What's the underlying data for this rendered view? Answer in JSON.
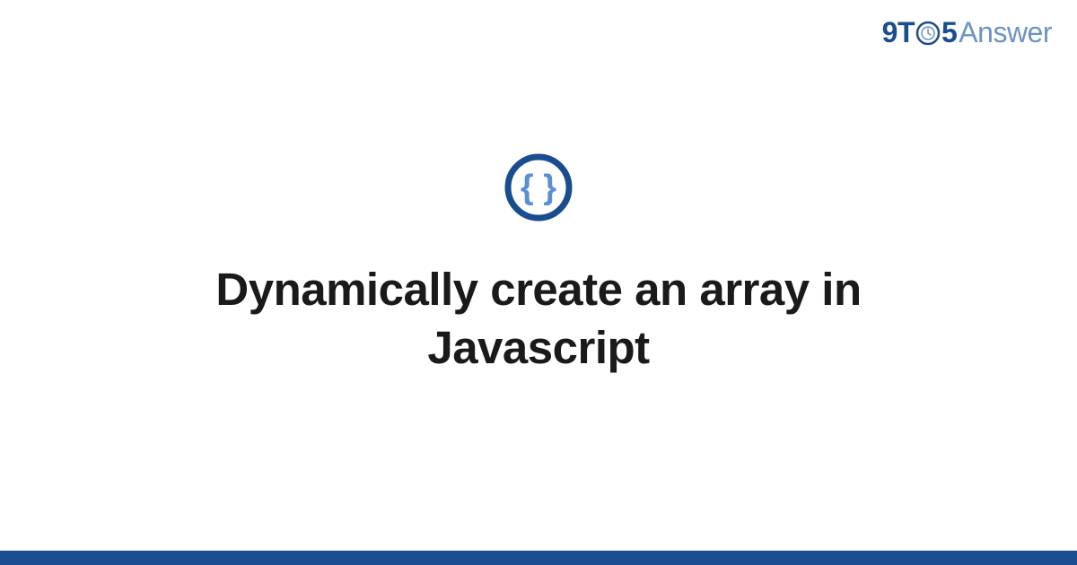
{
  "logo": {
    "part1": "9T",
    "part2": "5",
    "part3": "Answer"
  },
  "title": "Dynamically create an array in Javascript",
  "colors": {
    "primary": "#1a4d8f",
    "secondary": "#6b93c4",
    "iconBraces": "#5a8fd4",
    "iconRing": "#1a4d8f"
  }
}
